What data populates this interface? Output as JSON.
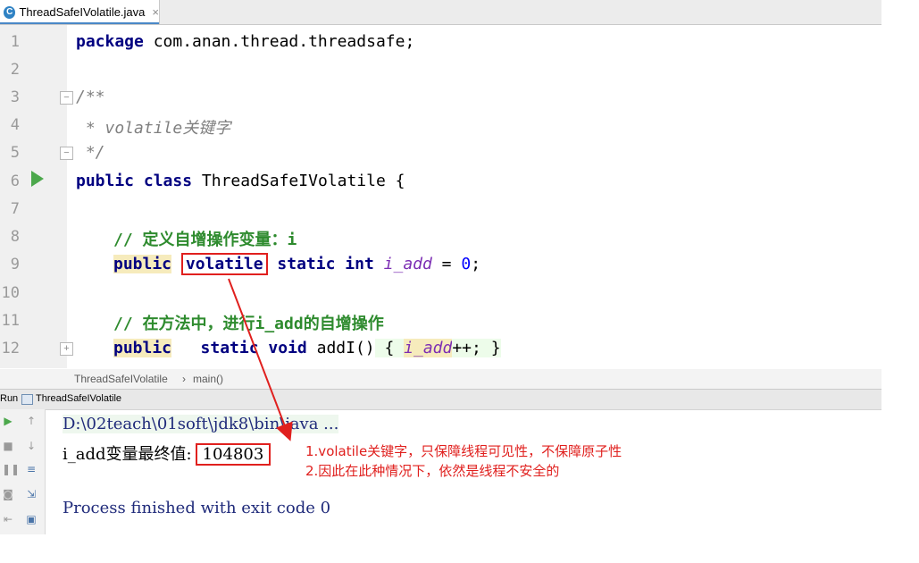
{
  "tab": {
    "title": "ThreadSafeIVolatile.java",
    "icon": "java-class-icon",
    "close": "×"
  },
  "line_numbers": [
    "1",
    "2",
    "3",
    "4",
    "5",
    "6",
    "7",
    "8",
    "9",
    "10",
    "11",
    "12"
  ],
  "code": {
    "l1_kw": "package",
    "l1_rest": " com.anan.thread.threadsafe;",
    "l3": "/**",
    "l4": " * volatile关键字",
    "l5": " */",
    "l6_kw1": "public",
    "l6_kw2": "class",
    "l6_rest": " ThreadSafeIVolatile {",
    "l8": "// 定义自增操作变量：i",
    "l9_kw1": "public",
    "l9_kw2": "volatile",
    "l9_kw3": "static",
    "l9_kw4": "int",
    "l9_field": "i_add",
    "l9_eq": " = ",
    "l9_num": "0",
    "l9_semi": ";",
    "l11": "// 在方法中，进行i_add的自增操作",
    "l12_kw1": "public",
    "l12_kw2": "static",
    "l12_kw3": "void",
    "l12_method": " addI()",
    "l12_open": " { ",
    "l12_field": "i_add",
    "l12_rest": "++; }"
  },
  "breadcrumb": {
    "class": "ThreadSafeIVolatile",
    "sep": "›",
    "method": "main()"
  },
  "run": {
    "label": "Run",
    "config": "ThreadSafeIVolatile",
    "cmd": "D:\\02teach\\01soft\\jdk8\\bin\\java ...",
    "output_label": "i_add变量最终值:",
    "output_value": "104803",
    "process": "Process finished with exit code 0"
  },
  "annotation": {
    "line1": "1.volatile关键字，只保障线程可见性，不保障原子性",
    "line2": "2.因此在此种情况下，依然是线程不安全的"
  },
  "colors": {
    "highlight_box": "#e0201e",
    "run_green": "#4ca84c"
  }
}
